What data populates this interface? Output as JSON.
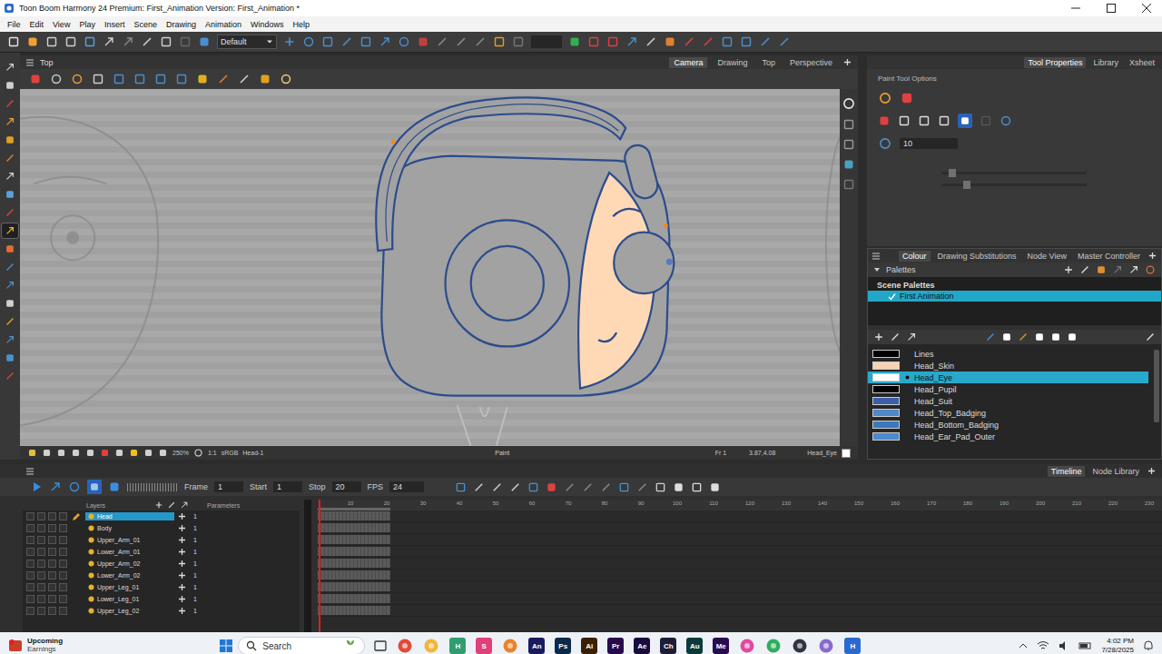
{
  "window": {
    "title": "Toon Boom Harmony 24 Premium: First_Animation Version: First_Animation *"
  },
  "menu": [
    "File",
    "Edit",
    "View",
    "Play",
    "Insert",
    "Scene",
    "Drawing",
    "Animation",
    "Windows",
    "Help"
  ],
  "toolbar": {
    "workspace": "Default"
  },
  "tools": [
    {
      "selected": false
    },
    {
      "selected": false
    },
    {
      "selected": false
    },
    {
      "selected": false
    },
    {
      "selected": false
    },
    {
      "selected": false
    },
    {
      "selected": false
    },
    {
      "selected": false
    },
    {
      "selected": false
    },
    {
      "selected": true
    },
    {
      "selected": false
    },
    {
      "selected": false
    },
    {
      "selected": false
    },
    {
      "selected": false
    },
    {
      "selected": false
    },
    {
      "selected": false
    },
    {
      "selected": false
    },
    {
      "selected": false
    }
  ],
  "view": {
    "title": "Top",
    "tabs": [
      {
        "label": "Camera",
        "selected": true
      },
      {
        "label": "Drawing",
        "selected": false
      },
      {
        "label": "Top",
        "selected": false
      },
      {
        "label": "Perspective",
        "selected": false
      }
    ],
    "status": {
      "zoom": "250%",
      "scale": "1:1",
      "color_space": "sRGB",
      "drawing": "Head-1",
      "tool": "Paint",
      "frame": "Fr 1",
      "coords": "3.87,4.08",
      "colour": "Head_Eye"
    }
  },
  "tool_properties": {
    "tabs": [
      {
        "label": "Tool Properties",
        "selected": true
      },
      {
        "label": "Library",
        "selected": false
      },
      {
        "label": "Xsheet",
        "selected": false
      }
    ],
    "title": "Paint Tool Options",
    "size": "10"
  },
  "colour_panel": {
    "tabs": [
      {
        "label": "Colour",
        "selected": true
      },
      {
        "label": "Drawing Substitutions",
        "selected": false
      },
      {
        "label": "Node View",
        "selected": false
      },
      {
        "label": "Master Controller",
        "selected": false
      }
    ],
    "palettes_label": "Palettes",
    "scene_palettes_label": "Scene Palettes",
    "palettes": [
      {
        "name": "First Animation",
        "selected": true,
        "checked": true
      }
    ],
    "swatches": [
      {
        "name": "Lines",
        "color": "#000000",
        "selected": false
      },
      {
        "name": "Head_Skin",
        "color": "#f6d3b3",
        "selected": false
      },
      {
        "name": "Head_Eye",
        "color": "#ffffff",
        "selected": true
      },
      {
        "name": "Head_Pupil",
        "color": "#000000",
        "selected": false
      },
      {
        "name": "Head_Suit",
        "color": "#3b5fa8",
        "selected": false
      },
      {
        "name": "Head_Top_Badging",
        "color": "#4f88c6",
        "selected": false
      },
      {
        "name": "Head_Bottom_Badging",
        "color": "#3a78bb",
        "selected": false
      },
      {
        "name": "Head_Ear_Pad_Outer",
        "color": "#4a8ad0",
        "selected": false
      }
    ]
  },
  "timeline": {
    "frame_label": "Frame",
    "frame": "1",
    "start_label": "Start",
    "start": "1",
    "stop_label": "Stop",
    "stop": "20",
    "fps_label": "FPS",
    "fps": "24",
    "tabs": [
      {
        "label": "Timeline",
        "selected": true
      },
      {
        "label": "Node Library",
        "selected": false
      }
    ],
    "columns": [
      "Layers",
      "Parameters"
    ],
    "playhead_frame": 1,
    "exposure_frames": 20,
    "ruler": [
      "10",
      "20",
      "30",
      "40",
      "50",
      "60",
      "70",
      "80",
      "90",
      "100",
      "110",
      "120",
      "130",
      "140",
      "150",
      "160",
      "170",
      "180",
      "190",
      "200",
      "210",
      "220",
      "230"
    ],
    "layers": [
      {
        "name": "Head",
        "value": "1",
        "selected": true
      },
      {
        "name": "Body",
        "value": "1",
        "selected": false
      },
      {
        "name": "Upper_Arm_01",
        "value": "1",
        "selected": false
      },
      {
        "name": "Lower_Arm_01",
        "value": "1",
        "selected": false
      },
      {
        "name": "Upper_Arm_02",
        "value": "1",
        "selected": false
      },
      {
        "name": "Lower_Arm_02",
        "value": "1",
        "selected": false
      },
      {
        "name": "Upper_Leg_01",
        "value": "1",
        "selected": false
      },
      {
        "name": "Lower_Leg_01",
        "value": "1",
        "selected": false
      },
      {
        "name": "Upper_Leg_02",
        "value": "1",
        "selected": false
      }
    ]
  },
  "taskbar": {
    "notification": {
      "title": "Upcoming",
      "subtitle": "Earnings"
    },
    "search": "Search",
    "apps": [
      {
        "kind": "dot",
        "label": "",
        "color": "#e04a3a"
      },
      {
        "kind": "dot",
        "label": "",
        "color": "#f2b53a"
      },
      {
        "kind": "tile",
        "label": "H",
        "color": "#2f9e6e"
      },
      {
        "kind": "tile",
        "label": "S",
        "color": "#e0407a"
      },
      {
        "kind": "dot",
        "label": "",
        "color": "#e9822a"
      },
      {
        "kind": "tile",
        "label": "An",
        "color": "#1a1a5e"
      },
      {
        "kind": "tile",
        "label": "Ps",
        "color": "#0b2a4a"
      },
      {
        "kind": "tile",
        "label": "Ai",
        "color": "#3a1f00"
      },
      {
        "kind": "tile",
        "label": "Pr",
        "color": "#2a0a4a"
      },
      {
        "kind": "tile",
        "label": "Ae",
        "color": "#1a0a40"
      },
      {
        "kind": "tile",
        "label": "Ch",
        "color": "#1d1d3a"
      },
      {
        "kind": "tile",
        "label": "Au",
        "color": "#0a3a3a"
      },
      {
        "kind": "tile",
        "label": "Me",
        "color": "#2a0a50"
      },
      {
        "kind": "dot",
        "label": "",
        "color": "#e04aa0"
      },
      {
        "kind": "dot",
        "label": "",
        "color": "#2fae5e"
      },
      {
        "kind": "dot",
        "label": "",
        "color": "#333344"
      },
      {
        "kind": "dot",
        "label": "",
        "color": "#8a6ad0"
      },
      {
        "kind": "tile",
        "label": "H",
        "color": "#2a6ad0"
      }
    ],
    "time": "4:02 PM",
    "date": "7/28/2025"
  }
}
